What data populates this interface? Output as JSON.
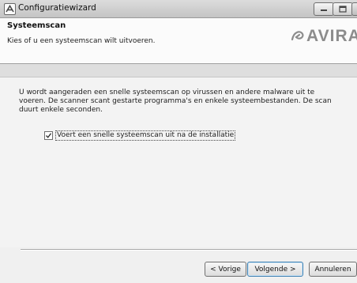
{
  "window": {
    "title": "Configuratiewizard"
  },
  "header": {
    "title": "Systeemscan",
    "subtitle": "Kies of u een systeemscan wilt uitvoeren.",
    "logo_text": "AVIRA"
  },
  "content": {
    "description": "U wordt aangeraden een snelle systeemscan op virussen en andere malware uit te voeren. De scanner scant gestarte programma's en enkele systeembestanden. De scan duurt enkele seconden.",
    "checkbox": {
      "label": "Voert een snelle systeemscan uit na de installatie",
      "checked": true
    }
  },
  "footer": {
    "prev_label": "< Vorige",
    "next_label": "Volgende >",
    "cancel_label": "Annuleren"
  },
  "colors": {
    "logo": "#8c8c8c",
    "default_button_border": "#3c7fb1"
  }
}
